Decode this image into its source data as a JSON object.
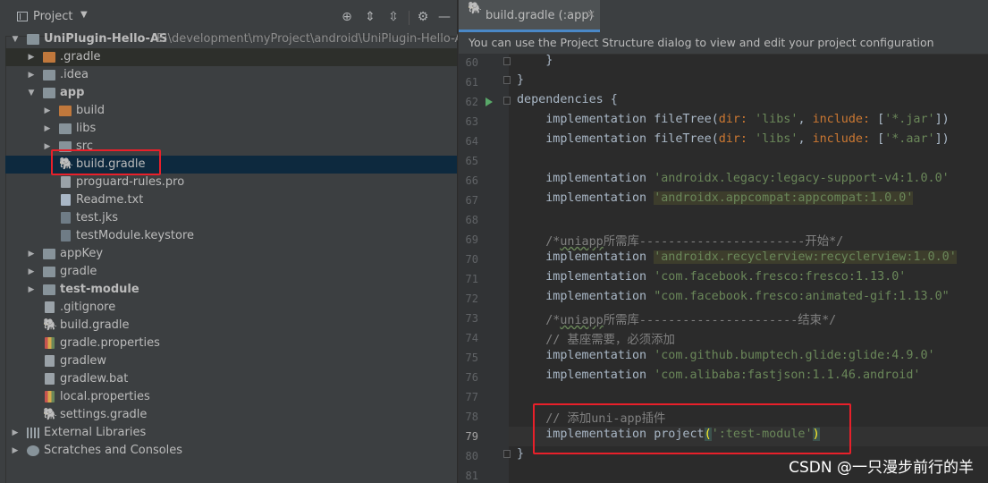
{
  "project_panel": {
    "title": "Project",
    "tree": [
      {
        "label": "UniPlugin-Hello-AS",
        "path": "E:\\development\\myProject\\android\\UniPlugin-Hello-AS",
        "bold": true
      },
      {
        "label": ".gradle"
      },
      {
        "label": ".idea"
      },
      {
        "label": "app",
        "bold": true
      },
      {
        "label": "build"
      },
      {
        "label": "libs"
      },
      {
        "label": "src"
      },
      {
        "label": "build.gradle"
      },
      {
        "label": "proguard-rules.pro"
      },
      {
        "label": "Readme.txt"
      },
      {
        "label": "test.jks"
      },
      {
        "label": "testModule.keystore"
      },
      {
        "label": "appKey"
      },
      {
        "label": "gradle"
      },
      {
        "label": "test-module",
        "bold": true
      },
      {
        "label": ".gitignore"
      },
      {
        "label": "build.gradle"
      },
      {
        "label": "gradle.properties"
      },
      {
        "label": "gradlew"
      },
      {
        "label": "gradlew.bat"
      },
      {
        "label": "local.properties"
      },
      {
        "label": "settings.gradle"
      },
      {
        "label": "External Libraries"
      },
      {
        "label": "Scratches and Consoles"
      }
    ]
  },
  "editor": {
    "tab_label": "build.gradle (:app)",
    "notice": "You can use the Project Structure dialog to view and edit your project configuration",
    "line_numbers": [
      "60",
      "61",
      "62",
      "63",
      "64",
      "65",
      "66",
      "67",
      "68",
      "69",
      "70",
      "71",
      "72",
      "73",
      "74",
      "75",
      "76",
      "77",
      "78",
      "79",
      "80",
      "81"
    ],
    "lines": {
      "l60": "}",
      "l61": "}",
      "l62a": "dependencies",
      "l62b": " {",
      "impl": "implementation",
      "filetree": "fileTree",
      "dir": "dir:",
      "libs_str": "'libs'",
      "include": "include:",
      "jar": "'*.jar'",
      "aar": "'*.aar'",
      "legacy": "'androidx.legacy:legacy-support-v4:1.0.0'",
      "appcompat": "'androidx.appcompat:appcompat:1.0.0'",
      "c69a": "/*",
      "c69b": "uniapp",
      "c69c": "所需库-----------------------开始*/",
      "recycler": "'androidx.recyclerview:recyclerview:1.0.0'",
      "fresco": "'com.facebook.fresco:fresco:1.13.0'",
      "gif": "\"com.facebook.fresco:animated-gif:1.13.0\"",
      "c73a": "/*",
      "c73b": "uniapp",
      "c73c": "所需库----------------------结束*/",
      "c74": "// 基座需要，必须添加",
      "glide": "'com.github.bumptech.glide:glide:4.9.0'",
      "fastjson": "'com.alibaba:fastjson:1.1.46.android'",
      "c78": "// 添加uni-app插件",
      "project": "project",
      "test_module": "':test-module'",
      "l80": "}"
    }
  },
  "watermark": "CSDN @一只漫步前行的羊"
}
